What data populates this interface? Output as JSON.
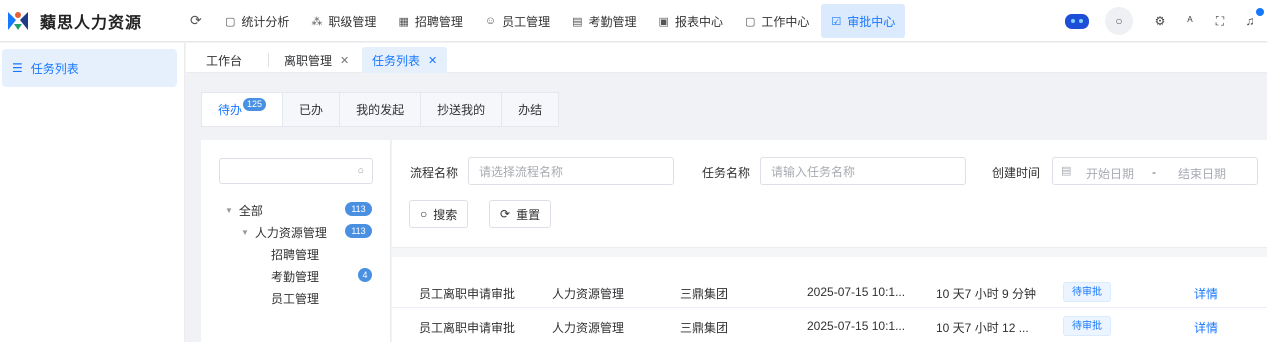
{
  "app": {
    "title": "蘱思人力资源"
  },
  "topnav": {
    "items": [
      {
        "label": "统计分析",
        "icon": "document-icon"
      },
      {
        "label": "职级管理",
        "icon": "org-chart-icon"
      },
      {
        "label": "招聘管理",
        "icon": "grid-icon"
      },
      {
        "label": "员工管理",
        "icon": "users-icon"
      },
      {
        "label": "考勤管理",
        "icon": "card-icon"
      },
      {
        "label": "报表中心",
        "icon": "chart-icon"
      },
      {
        "label": "工作中心",
        "icon": "document-icon"
      },
      {
        "label": "审批中心",
        "icon": "checkbox-icon",
        "active": true
      }
    ]
  },
  "sidebar": {
    "items": [
      {
        "label": "任务列表",
        "icon": "list-icon"
      }
    ]
  },
  "tabs": [
    {
      "label": "工作台"
    },
    {
      "label": "离职管理",
      "closable": true
    },
    {
      "label": "任务列表",
      "closable": true,
      "active": true
    }
  ],
  "subtabs": [
    {
      "label": "待办",
      "badge": "125",
      "active": true
    },
    {
      "label": "已办"
    },
    {
      "label": "我的发起"
    },
    {
      "label": "抄送我的"
    },
    {
      "label": "办结"
    }
  ],
  "tree": {
    "nodes": [
      {
        "label": "全部",
        "count": "113"
      },
      {
        "label": "人力资源管理",
        "count": "113"
      },
      {
        "label": "招聘管理",
        "count": ""
      },
      {
        "label": "考勤管理",
        "count": "4"
      },
      {
        "label": "员工管理",
        "count": ""
      }
    ]
  },
  "filters": {
    "process_label": "流程名称",
    "process_placeholder": "请选择流程名称",
    "task_label": "任务名称",
    "task_placeholder": "请输入任务名称",
    "created_label": "创建时间",
    "start_placeholder": "开始日期",
    "range_sep": "-",
    "end_placeholder": "结束日期",
    "search_label": "搜索",
    "reset_label": "重置"
  },
  "rows": [
    {
      "name": "员工离职申请审批",
      "category": "人力资源管理",
      "company": "三鼎集团",
      "created": "2025-07-15 10:1...",
      "duration": "10 天7 小时 9 分钟",
      "status": "待审批",
      "action": "详情"
    },
    {
      "name": "员工离职申请审批",
      "category": "人力资源管理",
      "company": "三鼎集团",
      "created": "2025-07-15 10:1...",
      "duration": "10 天7 小时 12 ...",
      "status": "待审批",
      "action": "详情"
    }
  ],
  "colors": {
    "accent": "#1677ff",
    "active_bg": "#e6f0fd",
    "badge": "#4a90e2"
  }
}
